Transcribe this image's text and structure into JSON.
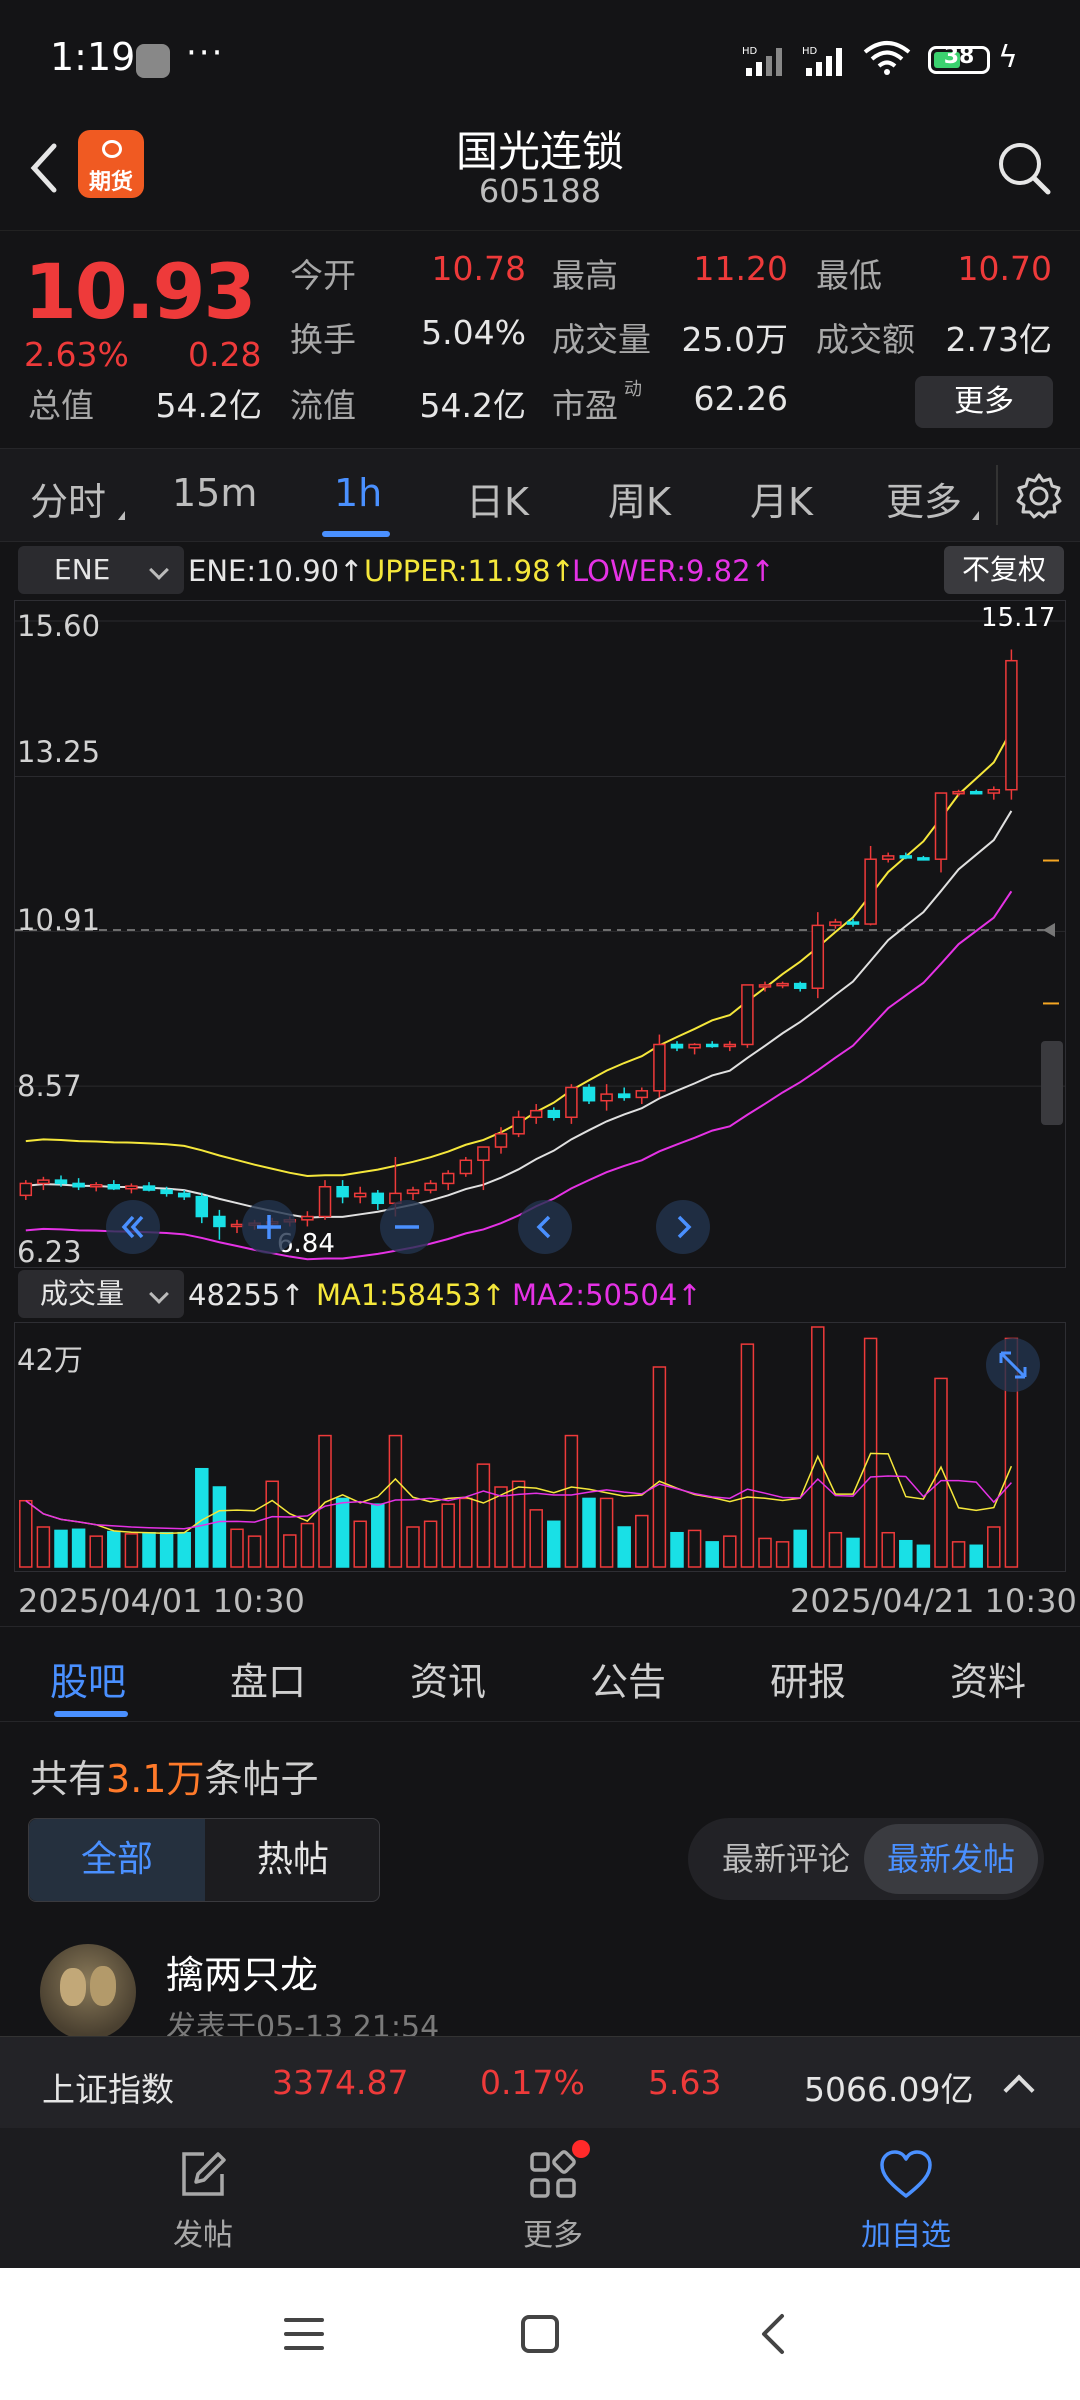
{
  "status_bar": {
    "time": "1:19",
    "dots": "···",
    "battery": "38"
  },
  "header": {
    "title": "国光连锁",
    "code": "605188",
    "logo_text": "期货"
  },
  "quote": {
    "price": "10.93",
    "change_pct": "2.63%",
    "change": "0.28",
    "open_label": "今开",
    "open": "10.78",
    "high_label": "最高",
    "high": "11.20",
    "low_label": "最低",
    "low": "10.70",
    "turnover_label": "换手",
    "turnover": "5.04%",
    "volume_label": "成交量",
    "volume": "25.0万",
    "amount_label": "成交额",
    "amount": "2.73亿",
    "mcap_label": "总值",
    "mcap": "54.2亿",
    "float_label": "流值",
    "float": "54.2亿",
    "pe_label": "市盈",
    "pe_sup": "动",
    "pe": "62.26",
    "more": "更多"
  },
  "chart_tabs": [
    {
      "label": "分时"
    },
    {
      "label": "15m"
    },
    {
      "label": "1h",
      "active": true
    },
    {
      "label": "日K"
    },
    {
      "label": "周K"
    },
    {
      "label": "月K"
    },
    {
      "label": "更多"
    }
  ],
  "indicator": {
    "selector": "ENE",
    "ene": "ENE:10.90↑",
    "upper": "UPPER:11.98↑",
    "lower": "LOWER:9.82↑",
    "adjust": "不复权"
  },
  "price_axis": {
    "p1": "15.60",
    "p2": "13.25",
    "p3": "10.91",
    "p4": "8.57",
    "p5": "6.23",
    "max_label": "15.17",
    "min_label": "6.84"
  },
  "volume": {
    "selector": "成交量",
    "vol": "48255↑",
    "ma1": "MA1:58453↑",
    "ma2": "MA2:50504↑",
    "axis_max": "42万"
  },
  "dates": {
    "start": "2025/04/01 10:30",
    "end": "2025/04/21 10:30"
  },
  "section_tabs": [
    {
      "label": "股吧",
      "active": true
    },
    {
      "label": "盘口"
    },
    {
      "label": "资讯"
    },
    {
      "label": "公告"
    },
    {
      "label": "研报"
    },
    {
      "label": "资料"
    }
  ],
  "posts": {
    "prefix": "共有",
    "count": "3.1万",
    "suffix": "条帖子",
    "filter_all": "全部",
    "filter_hot": "热帖",
    "sort_comment": "最新评论",
    "sort_post": "最新发帖",
    "first_author": "擒两只龙",
    "first_time": "发表于05-13 21:54"
  },
  "index_bar": {
    "name": "上证指数",
    "value": "3374.87",
    "pct": "0.17%",
    "change": "5.63",
    "amount": "5066.09亿"
  },
  "actions": {
    "post": "发帖",
    "more": "更多",
    "watch": "加自选"
  },
  "colors": {
    "up": "#ee3a3a",
    "down": "#19e0e6",
    "accent": "#4a90ff",
    "upper": "#f5e73b",
    "lower": "#e532e5",
    "mid": "#e0e0e0"
  },
  "chart_data": {
    "type": "candlestick",
    "period": "1h",
    "ylim": [
      6.23,
      15.6
    ],
    "ohlc": [
      [
        6.92,
        7.15,
        6.85,
        7.1
      ],
      [
        7.1,
        7.2,
        7.0,
        7.15
      ],
      [
        7.15,
        7.22,
        7.05,
        7.1
      ],
      [
        7.1,
        7.18,
        7.0,
        7.05
      ],
      [
        7.05,
        7.12,
        6.98,
        7.08
      ],
      [
        7.08,
        7.15,
        7.0,
        7.02
      ],
      [
        7.02,
        7.1,
        6.95,
        7.06
      ],
      [
        7.06,
        7.12,
        6.98,
        7.0
      ],
      [
        7.0,
        7.05,
        6.9,
        6.95
      ],
      [
        6.95,
        7.0,
        6.85,
        6.9
      ],
      [
        6.9,
        6.96,
        6.5,
        6.6
      ],
      [
        6.6,
        6.7,
        6.25,
        6.45
      ],
      [
        6.45,
        6.55,
        6.35,
        6.48
      ],
      [
        6.48,
        6.55,
        6.4,
        6.5
      ],
      [
        6.5,
        6.58,
        6.42,
        6.52
      ],
      [
        6.52,
        6.6,
        6.45,
        6.55
      ],
      [
        6.55,
        6.68,
        6.45,
        6.6
      ],
      [
        6.6,
        7.15,
        6.55,
        7.05
      ],
      [
        7.05,
        7.15,
        6.8,
        6.9
      ],
      [
        6.9,
        7.05,
        6.8,
        6.95
      ],
      [
        6.95,
        7.0,
        6.7,
        6.8
      ],
      [
        6.8,
        7.5,
        6.6,
        6.95
      ],
      [
        6.95,
        7.05,
        6.85,
        7.0
      ],
      [
        7.0,
        7.15,
        6.95,
        7.1
      ],
      [
        7.1,
        7.3,
        7.0,
        7.25
      ],
      [
        7.25,
        7.5,
        7.2,
        7.45
      ],
      [
        7.45,
        7.6,
        7.0,
        7.65
      ],
      [
        7.65,
        7.95,
        7.55,
        7.85
      ],
      [
        7.85,
        8.2,
        7.8,
        8.1
      ],
      [
        8.1,
        8.3,
        8.0,
        8.2
      ],
      [
        8.2,
        8.25,
        8.05,
        8.1
      ],
      [
        8.1,
        8.6,
        8.0,
        8.55
      ],
      [
        8.55,
        8.6,
        8.3,
        8.35
      ],
      [
        8.35,
        8.6,
        8.2,
        8.45
      ],
      [
        8.45,
        8.55,
        8.35,
        8.4
      ],
      [
        8.4,
        8.55,
        8.3,
        8.5
      ],
      [
        8.5,
        9.35,
        8.4,
        9.2
      ],
      [
        9.2,
        9.25,
        9.1,
        9.15
      ],
      [
        9.15,
        9.22,
        9.05,
        9.2
      ],
      [
        9.2,
        9.25,
        9.15,
        9.18
      ],
      [
        9.18,
        9.25,
        9.1,
        9.2
      ],
      [
        9.2,
        10.1,
        9.15,
        10.1
      ],
      [
        10.1,
        10.15,
        10.0,
        10.1
      ],
      [
        10.1,
        10.15,
        10.05,
        10.12
      ],
      [
        10.12,
        10.15,
        10.0,
        10.05
      ],
      [
        10.05,
        11.2,
        9.9,
        11.0
      ],
      [
        11.0,
        11.1,
        10.95,
        11.05
      ],
      [
        11.05,
        11.1,
        10.98,
        11.02
      ],
      [
        11.02,
        12.2,
        11.0,
        12.0
      ],
      [
        12.0,
        12.1,
        11.95,
        12.05
      ],
      [
        12.05,
        12.1,
        12.0,
        12.02
      ],
      [
        12.02,
        12.05,
        11.98,
        12.0
      ],
      [
        12.0,
        13.0,
        11.8,
        13.0
      ],
      [
        13.0,
        13.05,
        12.95,
        13.02
      ],
      [
        13.02,
        13.05,
        12.98,
        13.0
      ],
      [
        13.0,
        13.1,
        12.9,
        13.05
      ],
      [
        13.05,
        15.17,
        12.9,
        15.0
      ]
    ],
    "volume_max": 420000
  }
}
